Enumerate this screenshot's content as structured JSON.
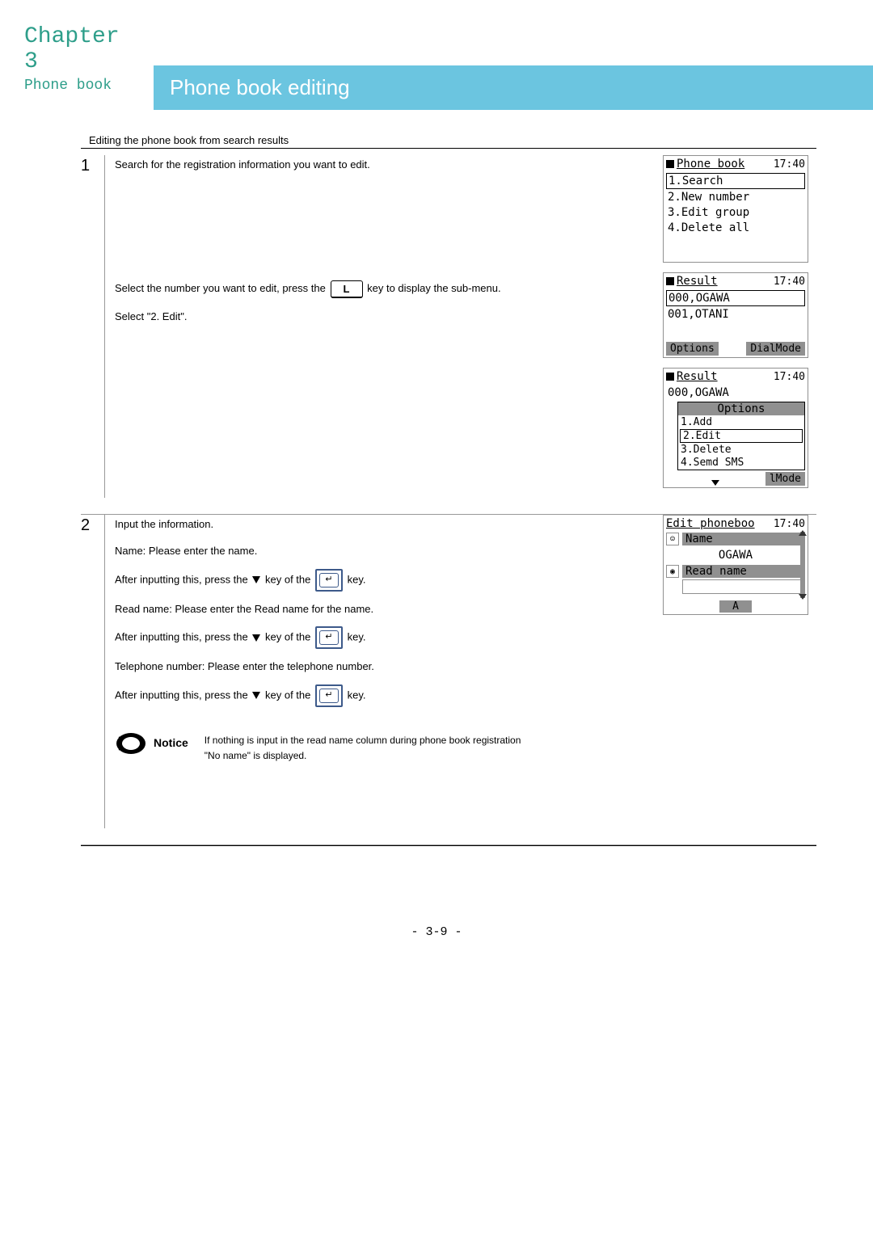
{
  "header": {
    "chapter": "Chapter 3",
    "subtitle": "Phone book",
    "pageTitle": "Phone book editing"
  },
  "sectionHeading": "Editing the phone book from search results",
  "step1": {
    "num": "1",
    "text1": "Search for the registration information you want to edit.",
    "text2a": "Select the number you want to edit, press the",
    "keyL": "L",
    "text2b": "key to display the sub-menu.",
    "text3": "Select \"2. Edit\".",
    "screen1": {
      "title": "Phone book",
      "time": "17:40",
      "items": [
        "1.Search",
        "2.New number",
        "3.Edit group",
        "4.Delete all"
      ]
    },
    "screen2": {
      "title": "Result",
      "time": "17:40",
      "items": [
        "000,OGAWA",
        "001,OTANI"
      ],
      "softkeys": [
        "Options",
        "DialMode"
      ]
    },
    "screen3": {
      "title": "Result",
      "time": "17:40",
      "topItem": "000,OGAWA",
      "popupTitle": "Options",
      "popupItems": [
        "1.Add",
        "2.Edit",
        "3.Delete",
        "4.Semd SMS"
      ],
      "softkey": "lMode"
    }
  },
  "step2": {
    "num": "2",
    "text1": "Input the information.",
    "text2": "Name:  Please enter the name.",
    "text3a": "After inputting this, press the",
    "text3b": "key of the",
    "text3c": "key.",
    "text4": "Read name:  Please enter the Read name for the name.",
    "text5": "Telephone number:  Please enter the telephone number.",
    "noticeLabel": "Notice",
    "noticeLine1": "If nothing is input in the read name column during phone book registration",
    "noticeLine2": " \"No name\" is displayed.",
    "screen": {
      "title": "Edit phoneboo",
      "time": "17:40",
      "nameLabel": "Name",
      "nameValue": "OGAWA",
      "readLabel": "Read name",
      "mode": "A"
    }
  },
  "pageNum": "- 3-9 -"
}
